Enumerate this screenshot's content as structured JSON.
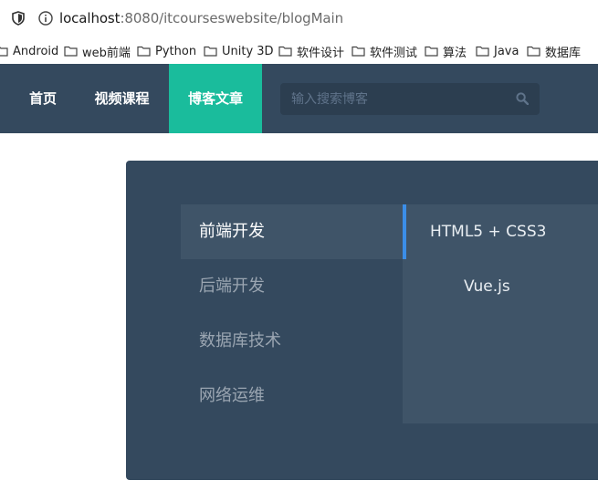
{
  "browser": {
    "url_host": "localhost",
    "url_rest": ":8080/itcourseswebsite/blogMain",
    "bookmarks": [
      "Android",
      "web前端",
      "Python",
      "Unity 3D",
      "软件设计",
      "软件测试",
      "算法",
      "Java",
      "数据库"
    ]
  },
  "nav": {
    "items": [
      "首页",
      "视频课程",
      "博客文章"
    ],
    "active_index": 2,
    "search_placeholder": "输入搜索博客"
  },
  "blog": {
    "categories": [
      "前端开发",
      "后端开发",
      "数据库技术",
      "网络运维"
    ],
    "active_category": 0,
    "subcategories": [
      "HTML5 + CSS3",
      "Vue.js"
    ]
  },
  "colors": {
    "navbar": "#34495e",
    "active_nav": "#1abc9c",
    "accent": "#3b8ee8"
  },
  "icons": {
    "shield": "shield-icon",
    "info": "info-icon",
    "folder": "folder-icon",
    "search": "search-icon"
  }
}
